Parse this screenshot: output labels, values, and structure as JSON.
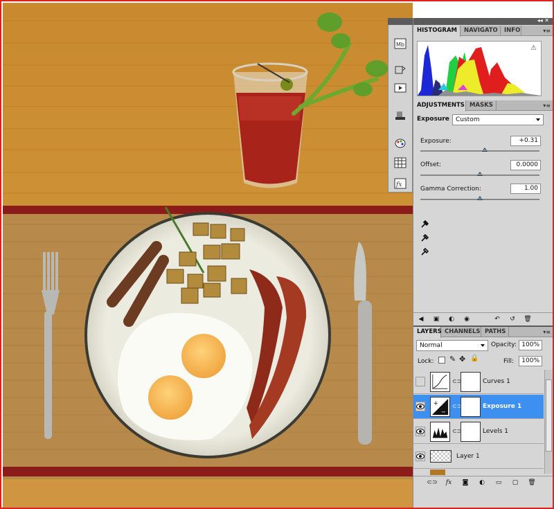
{
  "histogram_panel": {
    "tabs": [
      "HISTOGRAM",
      "NAVIGATO",
      "INFO"
    ]
  },
  "adjustments_panel": {
    "tabs": [
      "ADJUSTMENTS",
      "MASKS"
    ],
    "preset_label": "Exposure",
    "preset_value": "Custom",
    "exposure_label": "Exposure:",
    "exposure_value": "+0.31",
    "exposure_level": 0.54,
    "offset_label": "Offset:",
    "offset_value": "0.0000",
    "offset_level": 0.5,
    "gamma_label": "Gamma Correction:",
    "gamma_value": "1.00",
    "gamma_level": 0.5
  },
  "layers_panel": {
    "tabs": [
      "LAYERS",
      "CHANNELS",
      "PATHS"
    ],
    "blend_mode": "Normal",
    "opacity_label": "Opacity:",
    "opacity_value": "100%",
    "lock_label": "Lock:",
    "fill_label": "Fill:",
    "fill_value": "100%",
    "layers": [
      {
        "name": "Curves 1",
        "visible": false,
        "selected": false,
        "icon": "curves-icon"
      },
      {
        "name": "Exposure 1",
        "visible": true,
        "selected": true,
        "icon": "exposure-icon"
      },
      {
        "name": "Levels 1",
        "visible": true,
        "selected": false,
        "icon": "levels-icon"
      },
      {
        "name": "Layer 1",
        "visible": true,
        "selected": false,
        "icon": "transparent-thumb"
      }
    ]
  },
  "colors": {
    "frame": "#e0201c",
    "selection": "#3d8ff0",
    "panel": "#d6d6d6"
  }
}
